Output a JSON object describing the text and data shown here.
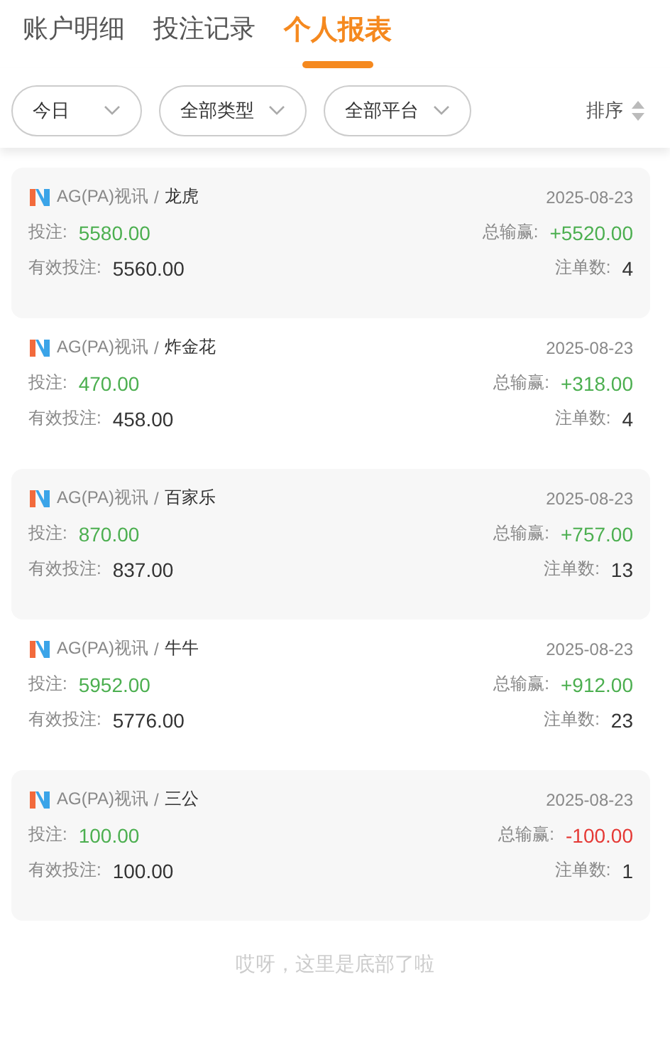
{
  "tabs": [
    {
      "label": "账户明细",
      "selected": false
    },
    {
      "label": "投注记录",
      "selected": false
    },
    {
      "label": "个人报表",
      "selected": true
    }
  ],
  "filters": [
    "今日",
    "全部类型",
    "全部平台"
  ],
  "sort": {
    "label": "排序"
  },
  "records": [
    {
      "platform": "AG(PA)视讯",
      "separator": "/",
      "game": "龙虎",
      "date": "2025-08-23",
      "bet_label": "投注:",
      "bet": "5580.00",
      "profit_label": "总输赢:",
      "profit": "+5520.00",
      "color": "#4caf50",
      "valid_label": "有效投注:",
      "valid": "5560.00",
      "count_label": "注单数:",
      "count": "4"
    },
    {
      "platform": "AG(PA)视讯",
      "separator": "/",
      "game": "炸金花",
      "date": "2025-08-23",
      "bet_label": "投注:",
      "bet": "470.00",
      "profit_label": "总输赢:",
      "profit": "+318.00",
      "color": "#4caf50",
      "valid_label": "有效投注:",
      "valid": "458.00",
      "count_label": "注单数:",
      "count": "4"
    },
    {
      "platform": "AG(PA)视讯",
      "separator": "/",
      "game": "百家乐",
      "date": "2025-08-23",
      "bet_label": "投注:",
      "bet": "870.00",
      "profit_label": "总输赢:",
      "profit": "+757.00",
      "color": "#4caf50",
      "valid_label": "有效投注:",
      "valid": "837.00",
      "count_label": "注单数:",
      "count": "13"
    },
    {
      "platform": "AG(PA)视讯",
      "separator": "/",
      "game": "牛牛",
      "date": "2025-08-23",
      "bet_label": "投注:",
      "bet": "5952.00",
      "profit_label": "总输赢:",
      "profit": "+912.00",
      "color": "#4caf50",
      "valid_label": "有效投注:",
      "valid": "5776.00",
      "count_label": "注单数:",
      "count": "23"
    },
    {
      "platform": "AG(PA)视讯",
      "separator": "/",
      "game": "三公",
      "date": "2025-08-23",
      "bet_label": "投注:",
      "bet": "100.00",
      "profit_label": "总输赢:",
      "profit": "-100.00",
      "color": "#e53935",
      "valid_label": "有效投注:",
      "valid": "100.00",
      "count_label": "注单数:",
      "count": "1"
    }
  ],
  "footer": "哎呀，这里是底部了啦"
}
